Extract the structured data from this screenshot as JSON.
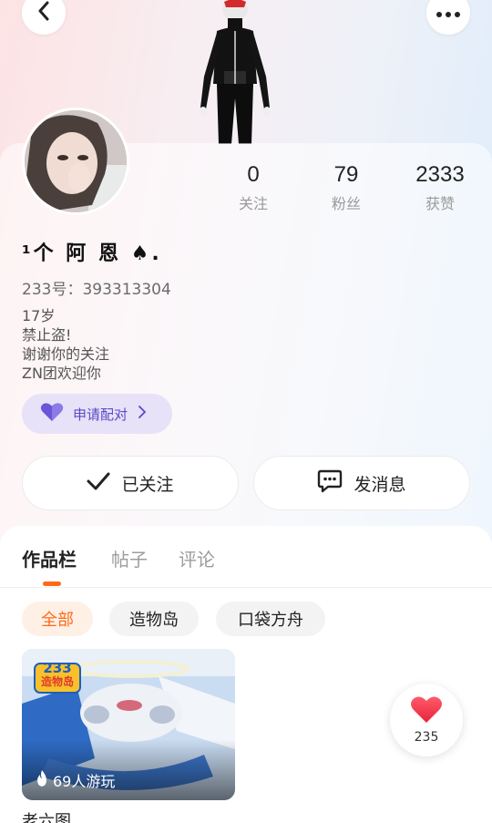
{
  "profile": {
    "nickname": "¹个 阿 恩 ♠.",
    "uid_line": "233号：393313304",
    "bio": [
      "17岁",
      "禁止盗!",
      "谢谢你的关注",
      "ZN团欢迎你"
    ]
  },
  "stats": [
    {
      "value": "0",
      "label": "关注"
    },
    {
      "value": "79",
      "label": "粉丝"
    },
    {
      "value": "2333",
      "label": "获赞"
    }
  ],
  "pair_button": {
    "label": "申请配对"
  },
  "actions": {
    "follow_label": "已关注",
    "message_label": "发消息"
  },
  "tabs": [
    {
      "label": "作品栏",
      "active": true
    },
    {
      "label": "帖子",
      "active": false
    },
    {
      "label": "评论",
      "active": false
    }
  ],
  "filters": [
    {
      "label": "全部",
      "active": true
    },
    {
      "label": "造物岛",
      "active": false
    },
    {
      "label": "口袋方舟",
      "active": false
    }
  ],
  "work": {
    "badge_line1": "233",
    "badge_line2": "造物岛",
    "plays": "69人游玩",
    "title": "老六图"
  },
  "like": {
    "count": "235"
  },
  "colors": {
    "accent": "#ff6a1a",
    "pair_purple": "#5a49c9",
    "like_red": "#f0394b"
  },
  "icons": [
    "back-icon",
    "more-icon",
    "heart-icon",
    "chevron-right-icon",
    "check-icon",
    "chat-icon",
    "fire-icon"
  ]
}
